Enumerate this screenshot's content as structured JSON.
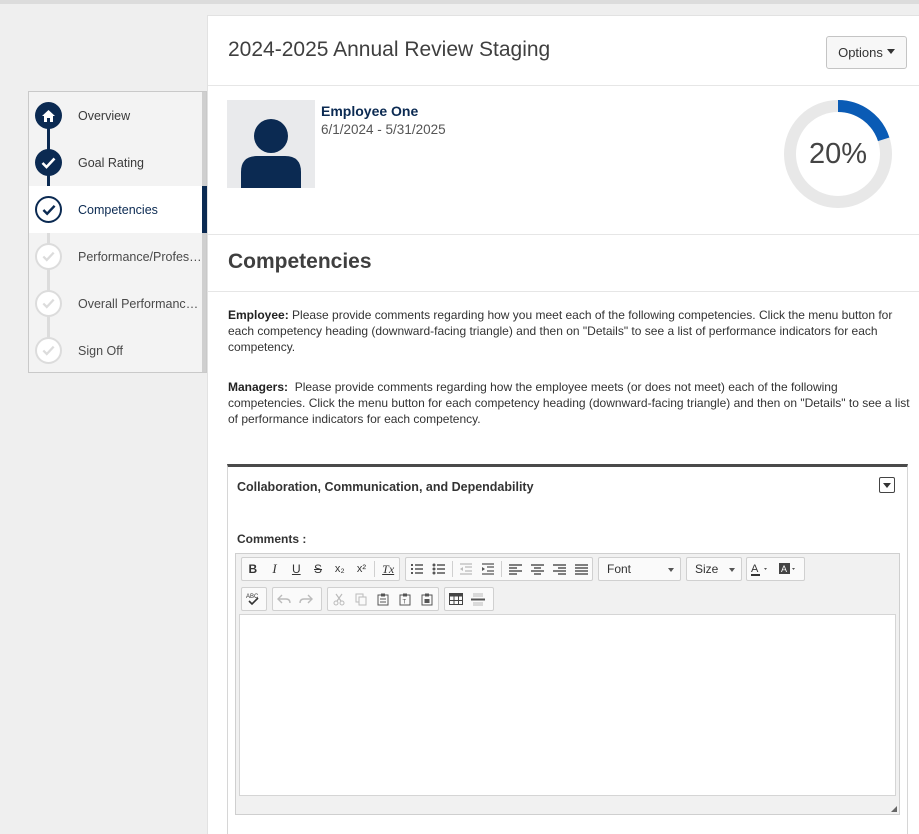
{
  "page": {
    "title": "2024-2025 Annual Review Staging",
    "options_label": "Options"
  },
  "sidebar": {
    "steps": [
      {
        "label": "Overview",
        "status": "done",
        "icon": "home-icon"
      },
      {
        "label": "Goal Rating",
        "status": "done",
        "icon": "check-icon"
      },
      {
        "label": "Competencies",
        "status": "current",
        "icon": "check-icon"
      },
      {
        "label": "Performance/Professi...",
        "status": "pending",
        "icon": "check-icon"
      },
      {
        "label": "Overall Performance R...",
        "status": "pending",
        "icon": "check-icon"
      },
      {
        "label": "Sign Off",
        "status": "pending",
        "icon": "check-icon"
      }
    ]
  },
  "employee": {
    "name": "Employee One",
    "dates": "6/1/2024 - 5/31/2025",
    "progress_label": "20%",
    "progress": 0.2,
    "avatar_icon": "user-avatar-icon"
  },
  "section": {
    "title": "Competencies",
    "employee_label": "Employee:",
    "employee_text": " Please provide comments regarding how you meet each of the following competencies. Click the menu button for each competency heading (downward-facing triangle) and then on \"Details\" to see a list of performance indicators for each competency.",
    "manager_label": "Managers:",
    "manager_text": "  Please provide comments regarding how the employee meets (or does not meet) each of the following competencies. Click the menu button for each competency heading (downward-facing triangle) and then on \"Details\" to see a list of performance indicators for each competency."
  },
  "competency": {
    "title": "Collaboration, Communication, and Dependability",
    "comments_label": "Comments :"
  },
  "editor": {
    "font_label": "Font",
    "size_label": "Size",
    "bold": "B",
    "italic": "I",
    "underline": "U",
    "strike": "S",
    "subscript": "x₂",
    "superscript": "x²",
    "clear": "Tx",
    "spellcheck": "ABC"
  },
  "colors": {
    "navy": "#0b2a52",
    "progress": "#0a5bb5",
    "track": "#e8e8e8"
  }
}
